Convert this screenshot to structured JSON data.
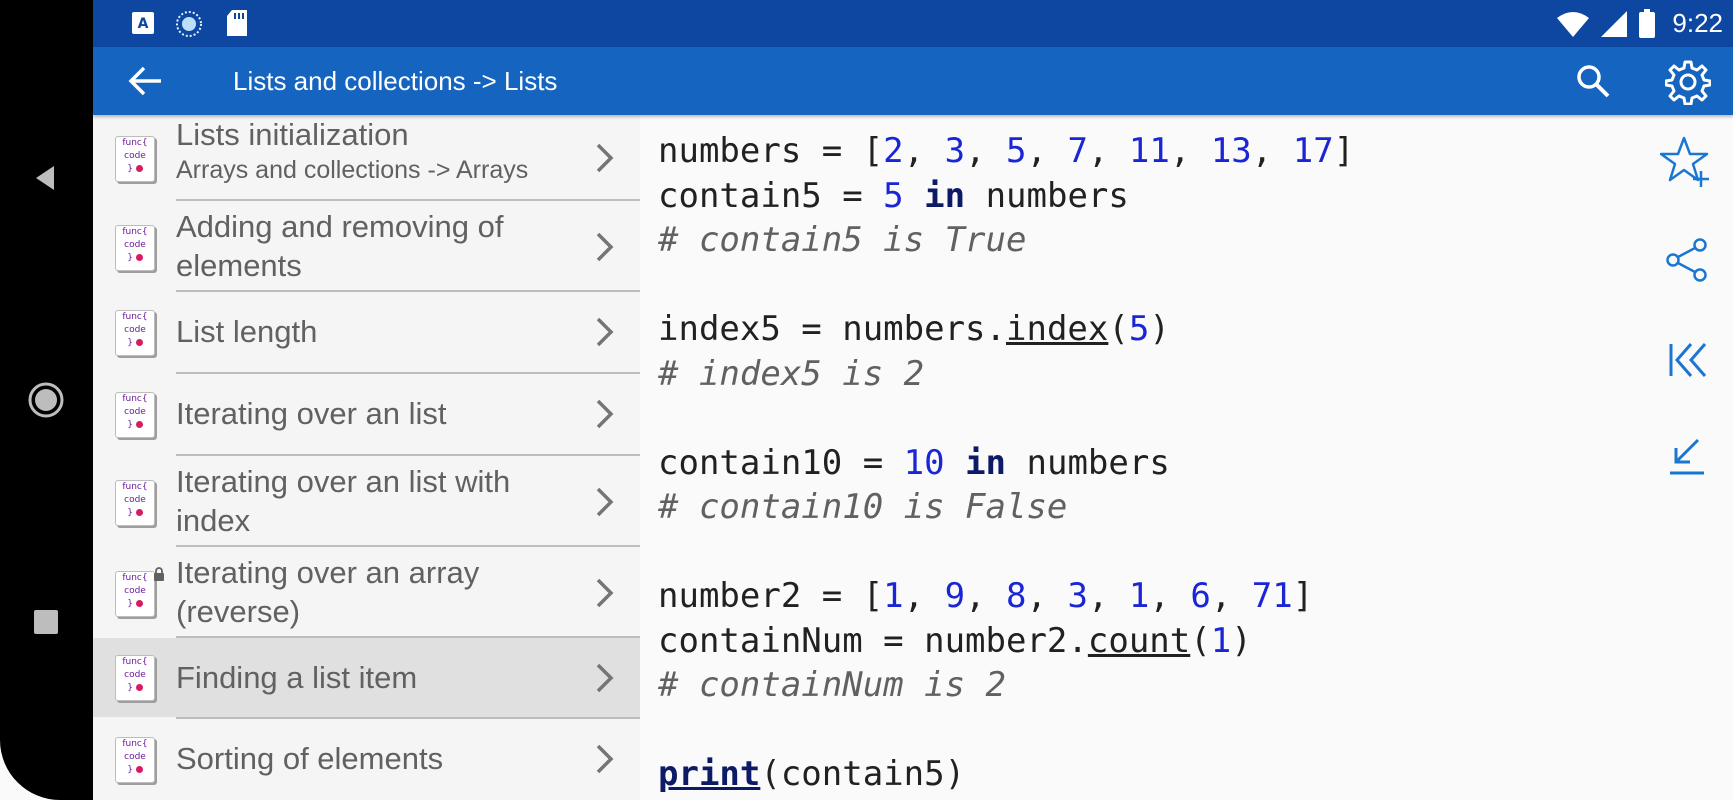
{
  "status_bar": {
    "time": "9:22",
    "icons": [
      "font-a-icon",
      "sync-icon",
      "sd-card-icon",
      "wifi-icon",
      "signal-icon",
      "battery-icon"
    ]
  },
  "app_bar": {
    "title": "Lists and collections -> Lists",
    "actions": [
      "back-arrow-icon",
      "search-icon",
      "gear-icon"
    ]
  },
  "list_items": [
    {
      "title": "Lists initialization",
      "subtitle": "Arrays and collections -> Arrays",
      "locked": false,
      "selected": false
    },
    {
      "title": "Adding and removing of elements",
      "subtitle": "",
      "locked": false,
      "selected": false
    },
    {
      "title": "List length",
      "subtitle": "",
      "locked": false,
      "selected": false
    },
    {
      "title": "Iterating over an list",
      "subtitle": "",
      "locked": false,
      "selected": false
    },
    {
      "title": "Iterating over an list with index",
      "subtitle": "",
      "locked": false,
      "selected": false
    },
    {
      "title": "Iterating over an array (reverse)",
      "subtitle": "",
      "locked": true,
      "selected": false
    },
    {
      "title": "Finding a list item",
      "subtitle": "",
      "locked": false,
      "selected": true
    },
    {
      "title": "Sorting of elements",
      "subtitle": "",
      "locked": false,
      "selected": false
    }
  ],
  "item_icon": {
    "line1": "func{",
    "line2": "code",
    "line3": "}"
  },
  "code_lines": [
    "numbers = [2, 3, 5, 7, 11, 13, 17]",
    "contain5 = 5 in numbers",
    "# contain5 is True",
    "",
    "index5 = numbers.index(5)",
    "# index5 is 2",
    "",
    "contain10 = 10 in numbers",
    "# contain10 is False",
    "",
    "number2 = [1, 9, 8, 3, 1, 6, 71]",
    "containNum = number2.count(1)",
    "# containNum is 2",
    "",
    "print(contain5)"
  ],
  "side_actions": [
    "star-plus-icon",
    "share-icon",
    "jump-to-first-icon",
    "collapse-icon"
  ],
  "colors": {
    "status_bar": "#0d47a1",
    "app_bar": "#1565c0",
    "code_number": "#1a25d6",
    "code_keyword": "#0d1a66",
    "code_comment": "#616161",
    "accent_icon": "#1976d2"
  }
}
